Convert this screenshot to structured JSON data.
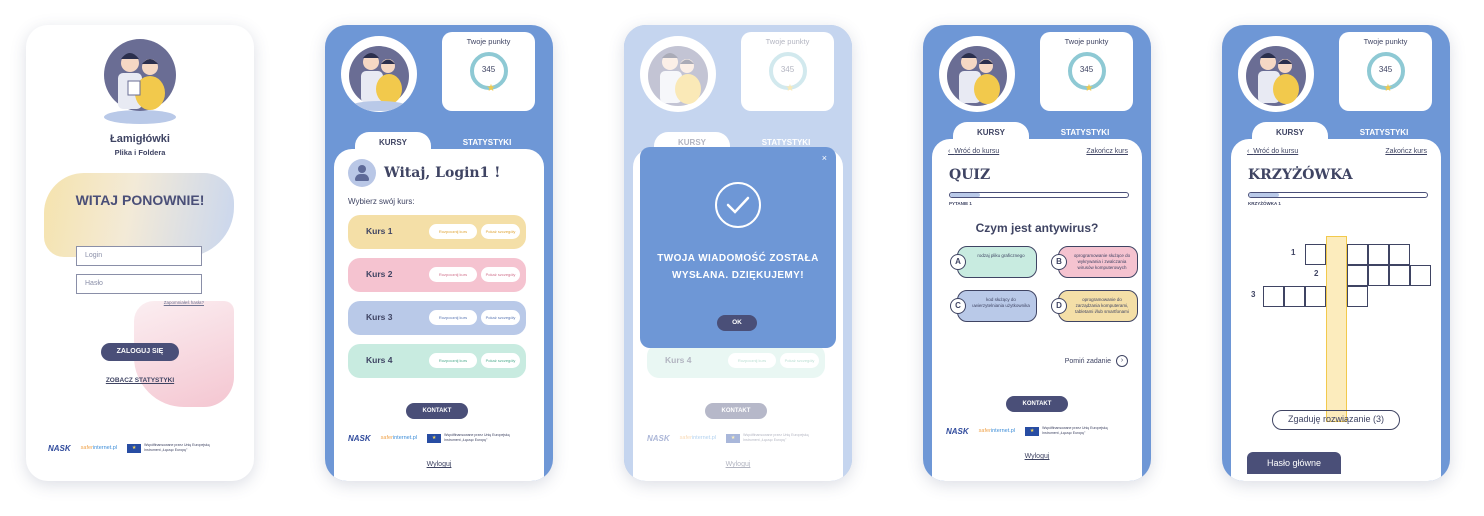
{
  "login": {
    "app_title": "Łamigłówki",
    "app_subtitle": "Plika i Foldera",
    "welcome": "WITAJ PONOWNIE!",
    "login_placeholder": "Login",
    "password_placeholder": "Hasło",
    "forgot": "Zapomniałeś hasła?",
    "login_button": "ZALOGUJ SIĘ",
    "stats_link": "ZOBACZ STATYSTYKI"
  },
  "header": {
    "points_title": "Twoje punkty",
    "points_value": "345",
    "tab_courses": "KURSY",
    "tab_stats": "STATYSTYKI"
  },
  "courses_screen": {
    "greeting": "Witaj, Login1 !",
    "choose": "Wybierz swój kurs:",
    "courses": [
      {
        "name": "Kurs 1",
        "start": "Rozpocznij kurs",
        "details": "Pokaż szczegóły"
      },
      {
        "name": "Kurs 2",
        "start": "Rozpocznij kurs",
        "details": "Pokaż szczegóły"
      },
      {
        "name": "Kurs 3",
        "start": "Rozpocznij kurs",
        "details": "Pokaż szczegóły"
      },
      {
        "name": "Kurs 4",
        "start": "Rozpocznij kurs",
        "details": "Pokaż szczegóły"
      }
    ],
    "contact": "KONTAKT",
    "logout": "Wyloguj"
  },
  "sponsors": {
    "nask": "NASK",
    "safer_a": "safer",
    "safer_b": "internet.pl",
    "eu_line1": "Współfinansowane przez Unię Europejską",
    "eu_line2": "Instrument „Łącząc Europę”"
  },
  "modal": {
    "close": "×",
    "message": "TWOJA WIADOMOŚĆ ZOSTAŁA WYSŁANA. DZIĘKUJEMY!",
    "ok": "OK"
  },
  "quiz": {
    "back": "Wróć do kursu",
    "end": "Zakończ kurs",
    "title": "QUIZ",
    "progress": 0.17,
    "progress_label": "PYTANIE 1",
    "question": "Czym jest antywirus?",
    "answers": [
      {
        "letter": "A",
        "text": "rodzaj pliku graficznego",
        "color": "#c8ebe0"
      },
      {
        "letter": "B",
        "text": "oprogramowanie służące do wykrywania i zwalczania wirusów komputerowych",
        "color": "#f5c3d0"
      },
      {
        "letter": "C",
        "text": "kod służący do uwierzytelniania użytkownika",
        "color": "#b9c9e8"
      },
      {
        "letter": "D",
        "text": "oprogramowanie do zarządzania komputerami, tabletami i/lub smartfonami",
        "color": "#f4dfa7"
      }
    ],
    "skip": "Pomiń zadanie"
  },
  "crossword": {
    "back": "Wróć do kursu",
    "end": "Zakończ kurs",
    "title": "KRZYŻÓWKA",
    "progress": 0.17,
    "progress_label": "KRZYŻÓWKA 1",
    "row_numbers": [
      "1",
      "2",
      "3"
    ],
    "guess_button": "Zgaduję rozwiązanie (3)",
    "haslo_button": "Hasło główne"
  }
}
